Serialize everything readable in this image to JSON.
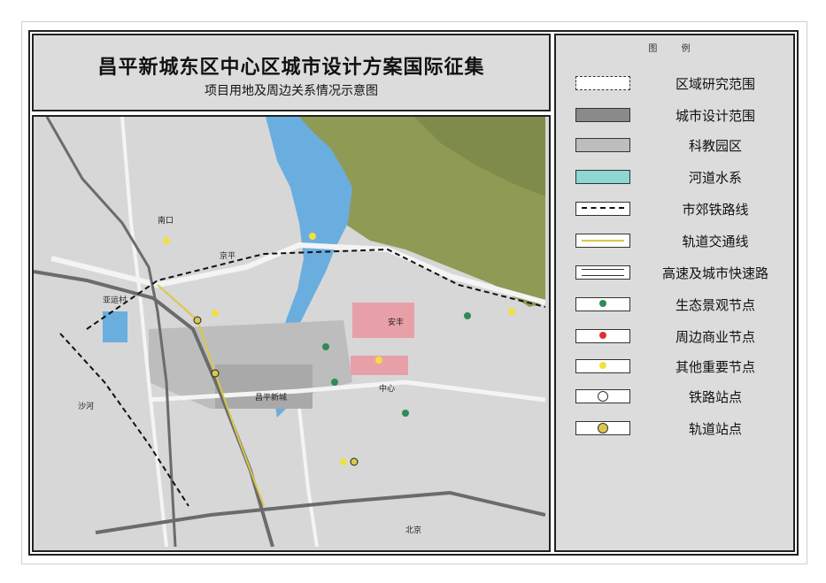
{
  "title": {
    "main": "昌平新城东区中心区城市设计方案国际征集",
    "sub": "项目用地及周边关系情况示意图"
  },
  "legend": {
    "heading": "图 例",
    "items": [
      {
        "label": "区域研究范围",
        "kind": "dashed-box"
      },
      {
        "label": "城市设计范围",
        "kind": "dark-box"
      },
      {
        "label": "科教园区",
        "kind": "grey-box"
      },
      {
        "label": "河道水系",
        "kind": "water-box"
      },
      {
        "label": "市郊铁路线",
        "kind": "rail-dash"
      },
      {
        "label": "轨道交通线",
        "kind": "yellow-line"
      },
      {
        "label": "高速及城市快速路",
        "kind": "double-line"
      },
      {
        "label": "生态景观节点",
        "kind": "green-dot"
      },
      {
        "label": "周边商业节点",
        "kind": "red-dot"
      },
      {
        "label": "其他重要节点",
        "kind": "yellow-dot"
      },
      {
        "label": "铁路站点",
        "kind": "station-circle"
      },
      {
        "label": "轨道站点",
        "kind": "metro-circle"
      }
    ]
  },
  "colors": {
    "water": "#6aaee0",
    "green": "#8f9a55",
    "research_area": "#bdbdbd",
    "commercial": "#e8a0a8",
    "urban_design": "#a4a4a4",
    "map_bg": "#d7d7d7",
    "road_white": "#f4f4f4",
    "highway": "#6b6b6b",
    "rail": "#111111",
    "metro": "#d9c84a"
  },
  "map": {
    "labels": [
      "亚运村",
      "京平",
      "安丰",
      "中心",
      "沙河",
      "南口",
      "昌平新城",
      "北京"
    ],
    "markers": {
      "ecology": 4,
      "commercial": 0,
      "other": 6
    }
  }
}
